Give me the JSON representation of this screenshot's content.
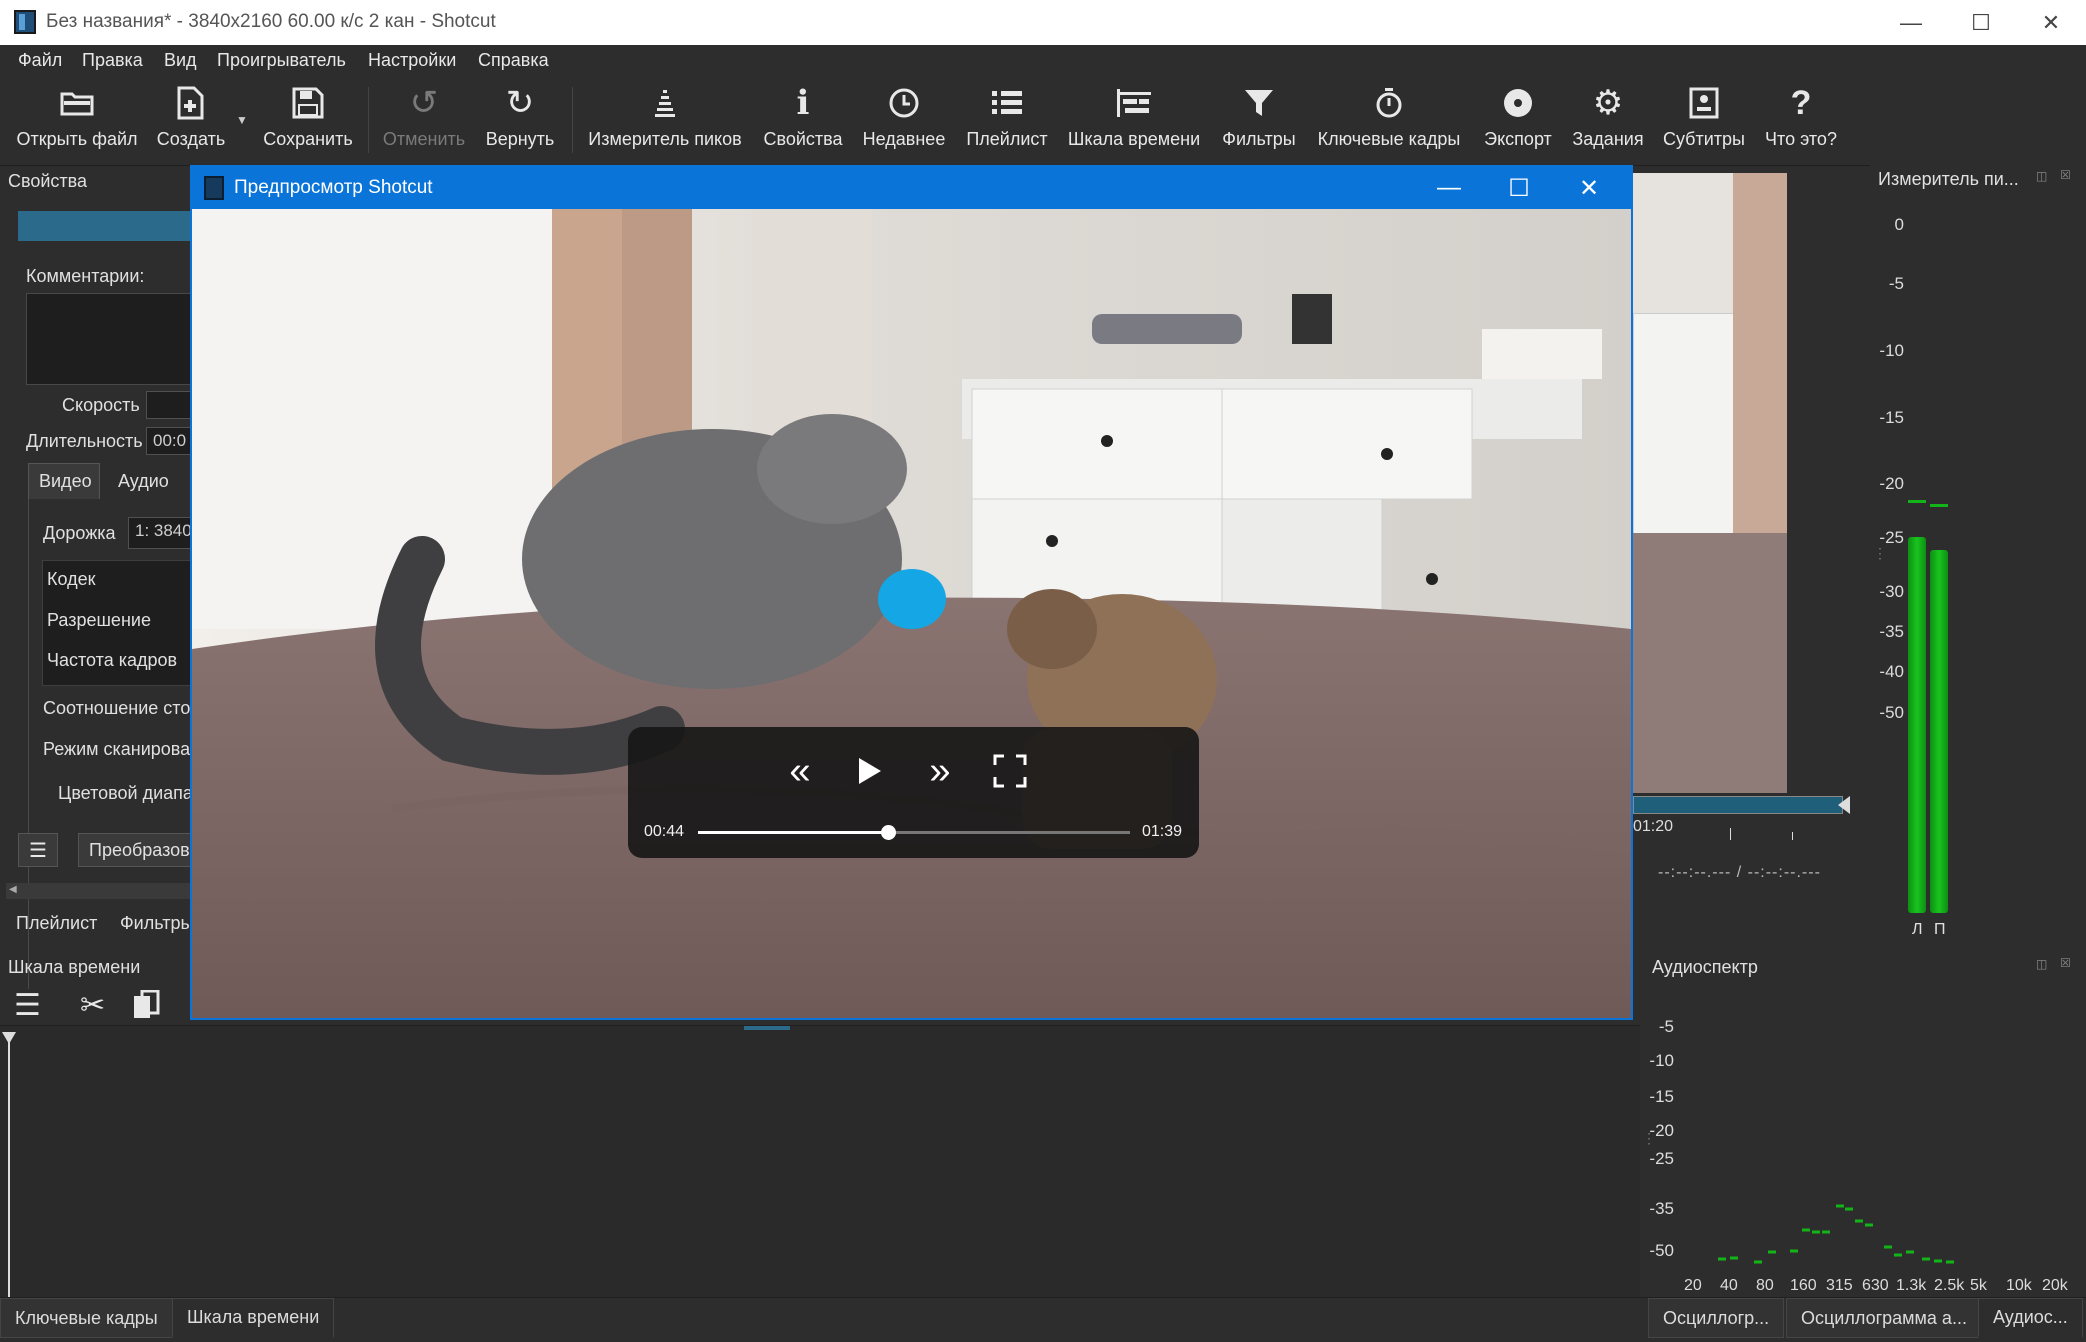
{
  "window": {
    "title": "Без названия* - 3840x2160 60.00 к/с 2 кан - Shotcut"
  },
  "menu": [
    "Файл",
    "Правка",
    "Вид",
    "Проигрыватель",
    "Настройки",
    "Справка"
  ],
  "toolbar": {
    "items": [
      {
        "label": "Открыть файл",
        "icon": "folder-open-icon"
      },
      {
        "label": "Создать",
        "icon": "new-file-icon"
      },
      {
        "label": "Сохранить",
        "icon": "save-icon"
      },
      {
        "label": "Отменить",
        "icon": "undo-icon",
        "disabled": true
      },
      {
        "label": "Вернуть",
        "icon": "redo-icon"
      },
      {
        "label": "Измеритель пиков",
        "icon": "peak-meter-icon"
      },
      {
        "label": "Свойства",
        "icon": "info-icon"
      },
      {
        "label": "Недавнее",
        "icon": "clock-icon"
      },
      {
        "label": "Плейлист",
        "icon": "list-icon"
      },
      {
        "label": "Шкала времени",
        "icon": "timeline-icon"
      },
      {
        "label": "Фильтры",
        "icon": "filter-icon"
      },
      {
        "label": "Ключевые кадры",
        "icon": "stopwatch-icon"
      },
      {
        "label": "Экспорт",
        "icon": "disc-icon"
      },
      {
        "label": "Задания",
        "icon": "gear-icon"
      },
      {
        "label": "Субтитры",
        "icon": "subtitles-icon"
      },
      {
        "label": "Что это?",
        "icon": "question-icon"
      }
    ]
  },
  "properties": {
    "panel_title": "Свойства",
    "comments_label": "Комментарии:",
    "speed_label": "Скорость",
    "duration_label": "Длительность",
    "duration_value": "00:0",
    "tab_video": "Видео",
    "tab_audio": "Аудио",
    "track_label": "Дорожка",
    "track_value": "1: 3840",
    "codec_label": "Кодек",
    "resolution_label": "Разрешение",
    "framerate_label": "Частота кадров",
    "aspect_label": "Соотношение сто",
    "scan_label": "Режим сканирова",
    "color_range_label": "Цветовой диапа",
    "convert_button": "Преобразов",
    "tab_playlist": "Плейлист",
    "tab_filters": "Фильтры"
  },
  "timeline": {
    "panel_title": "Шкала времени"
  },
  "preview": {
    "title": "Предпросмотр Shotcut",
    "time_current": "00:44",
    "time_total": "01:39",
    "progress": 0.44
  },
  "player": {
    "time_mark": "01:20",
    "timecode": "--:--:--.--- / --:--:--.---"
  },
  "peak_meter": {
    "panel_title": "Измеритель пи...",
    "scale": [
      "0",
      "-5",
      "-10",
      "-15",
      "-20",
      "-25",
      "-30",
      "-35",
      "-40",
      "-50"
    ],
    "channel_labels": [
      "Л",
      "П"
    ],
    "levels_db": [
      -24,
      -25
    ],
    "peaks_db": [
      -20.5,
      -20.8
    ]
  },
  "spectrum": {
    "panel_title": "Аудиоспектр",
    "scale": [
      "-5",
      "-10",
      "-15",
      "-20",
      "-25",
      "-35",
      "-50"
    ],
    "freq_labels": [
      "20",
      "40",
      "80",
      "160",
      "315",
      "630",
      "1.3k",
      "2.5k",
      "5k",
      "10k",
      "20k"
    ]
  },
  "bottom_tabs": {
    "left": [
      "Ключевые кадры",
      "Шкала времени"
    ],
    "right": [
      "Осциллогр...",
      "Осциллограмма а...",
      "Аудиос..."
    ]
  },
  "colors": {
    "accent": "#0a74d8",
    "meter_green": "#12b418",
    "background": "#2d2d2d"
  }
}
